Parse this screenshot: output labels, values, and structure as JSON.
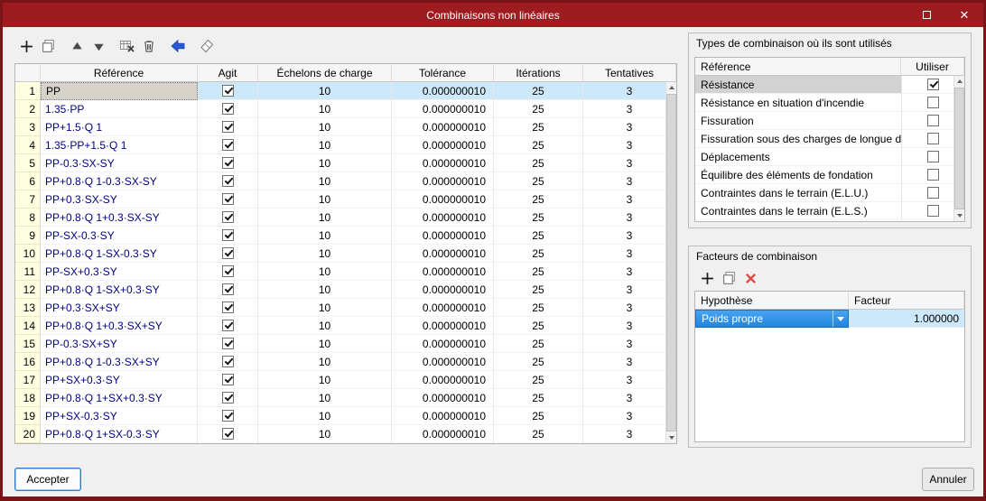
{
  "window": {
    "title": "Combinaisons non linéaires"
  },
  "main_toolbar": {
    "icons": [
      "add",
      "duplicate",
      "move-up",
      "move-down",
      "remove-row",
      "delete",
      "assign-arrow",
      "erase"
    ]
  },
  "main_table": {
    "columns": [
      "Référence",
      "Agit",
      "Échelons de charge",
      "Tolérance",
      "Itérations",
      "Tentatives"
    ],
    "rows": [
      {
        "n": "1",
        "ref": "PP",
        "agit": true,
        "steps": "10",
        "tol": "0.000000010",
        "iter": "25",
        "tries": "3",
        "selected": true
      },
      {
        "n": "2",
        "ref": "1.35·PP",
        "agit": true,
        "steps": "10",
        "tol": "0.000000010",
        "iter": "25",
        "tries": "3"
      },
      {
        "n": "3",
        "ref": "PP+1.5·Q 1",
        "agit": true,
        "steps": "10",
        "tol": "0.000000010",
        "iter": "25",
        "tries": "3"
      },
      {
        "n": "4",
        "ref": "1.35·PP+1.5·Q 1",
        "agit": true,
        "steps": "10",
        "tol": "0.000000010",
        "iter": "25",
        "tries": "3"
      },
      {
        "n": "5",
        "ref": "PP-0.3·SX-SY",
        "agit": true,
        "steps": "10",
        "tol": "0.000000010",
        "iter": "25",
        "tries": "3"
      },
      {
        "n": "6",
        "ref": "PP+0.8·Q 1-0.3·SX-SY",
        "agit": true,
        "steps": "10",
        "tol": "0.000000010",
        "iter": "25",
        "tries": "3"
      },
      {
        "n": "7",
        "ref": "PP+0.3·SX-SY",
        "agit": true,
        "steps": "10",
        "tol": "0.000000010",
        "iter": "25",
        "tries": "3"
      },
      {
        "n": "8",
        "ref": "PP+0.8·Q 1+0.3·SX-SY",
        "agit": true,
        "steps": "10",
        "tol": "0.000000010",
        "iter": "25",
        "tries": "3"
      },
      {
        "n": "9",
        "ref": "PP-SX-0.3·SY",
        "agit": true,
        "steps": "10",
        "tol": "0.000000010",
        "iter": "25",
        "tries": "3"
      },
      {
        "n": "10",
        "ref": "PP+0.8·Q 1-SX-0.3·SY",
        "agit": true,
        "steps": "10",
        "tol": "0.000000010",
        "iter": "25",
        "tries": "3"
      },
      {
        "n": "11",
        "ref": "PP-SX+0.3·SY",
        "agit": true,
        "steps": "10",
        "tol": "0.000000010",
        "iter": "25",
        "tries": "3"
      },
      {
        "n": "12",
        "ref": "PP+0.8·Q 1-SX+0.3·SY",
        "agit": true,
        "steps": "10",
        "tol": "0.000000010",
        "iter": "25",
        "tries": "3"
      },
      {
        "n": "13",
        "ref": "PP+0.3·SX+SY",
        "agit": true,
        "steps": "10",
        "tol": "0.000000010",
        "iter": "25",
        "tries": "3"
      },
      {
        "n": "14",
        "ref": "PP+0.8·Q 1+0.3·SX+SY",
        "agit": true,
        "steps": "10",
        "tol": "0.000000010",
        "iter": "25",
        "tries": "3"
      },
      {
        "n": "15",
        "ref": "PP-0.3·SX+SY",
        "agit": true,
        "steps": "10",
        "tol": "0.000000010",
        "iter": "25",
        "tries": "3"
      },
      {
        "n": "16",
        "ref": "PP+0.8·Q 1-0.3·SX+SY",
        "agit": true,
        "steps": "10",
        "tol": "0.000000010",
        "iter": "25",
        "tries": "3"
      },
      {
        "n": "17",
        "ref": "PP+SX+0.3·SY",
        "agit": true,
        "steps": "10",
        "tol": "0.000000010",
        "iter": "25",
        "tries": "3"
      },
      {
        "n": "18",
        "ref": "PP+0.8·Q 1+SX+0.3·SY",
        "agit": true,
        "steps": "10",
        "tol": "0.000000010",
        "iter": "25",
        "tries": "3"
      },
      {
        "n": "19",
        "ref": "PP+SX-0.3·SY",
        "agit": true,
        "steps": "10",
        "tol": "0.000000010",
        "iter": "25",
        "tries": "3"
      },
      {
        "n": "20",
        "ref": "PP+0.8·Q 1+SX-0.3·SY",
        "agit": true,
        "steps": "10",
        "tol": "0.000000010",
        "iter": "25",
        "tries": "3"
      }
    ]
  },
  "types_panel": {
    "title": "Types de combinaison où ils sont utilisés",
    "columns": [
      "Référence",
      "Utiliser"
    ],
    "rows": [
      {
        "label": "Résistance",
        "checked": true,
        "selected": true
      },
      {
        "label": "Résistance en situation d'incendie",
        "checked": false
      },
      {
        "label": "Fissuration",
        "checked": false
      },
      {
        "label": "Fissuration sous des charges de longue dur...",
        "checked": false
      },
      {
        "label": "Déplacements",
        "checked": false
      },
      {
        "label": "Équilibre des éléments de fondation",
        "checked": false
      },
      {
        "label": "Contraintes dans le terrain (E.L.U.)",
        "checked": false
      },
      {
        "label": "Contraintes dans le terrain (E.L.S.)",
        "checked": false
      }
    ]
  },
  "factors_panel": {
    "title": "Facteurs de combinaison",
    "toolbar_icons": [
      "add",
      "duplicate",
      "delete"
    ],
    "columns": [
      "Hypothèse",
      "Facteur"
    ],
    "rows": [
      {
        "hypothese": "Poids propre",
        "facteur": "1.000000"
      }
    ]
  },
  "buttons": {
    "accept": "Accepter",
    "cancel": "Annuler"
  },
  "icons": {
    "close": "✕"
  }
}
